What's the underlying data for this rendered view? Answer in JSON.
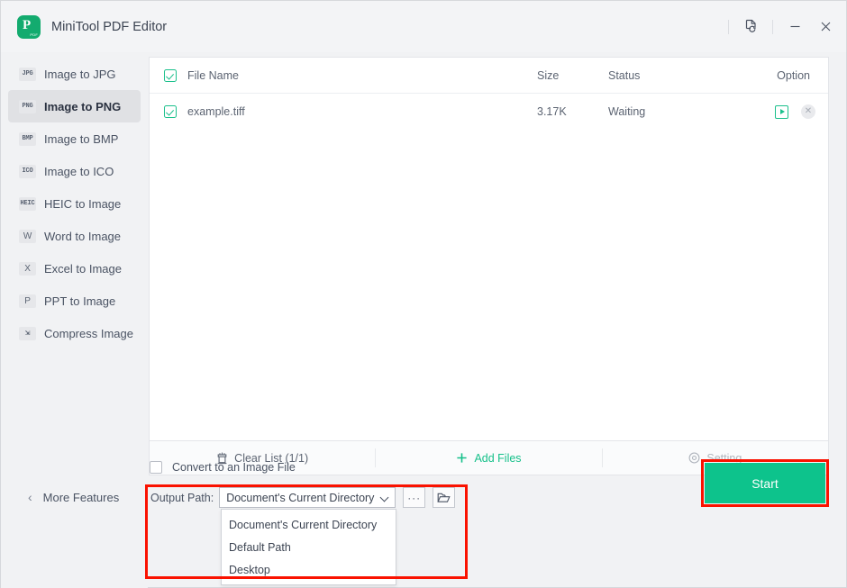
{
  "window": {
    "title": "MiniTool PDF Editor",
    "logo_letter": "P",
    "logo_sub": "PDF",
    "controls": [
      {
        "name": "document-refresh-icon",
        "label": ""
      },
      {
        "name": "minimize-icon",
        "label": ""
      },
      {
        "name": "close-icon",
        "label": ""
      }
    ]
  },
  "sidebar": {
    "items": [
      {
        "badge": "JPG",
        "label": "Image to JPG",
        "active": false
      },
      {
        "badge": "PNG",
        "label": "Image to PNG",
        "active": true
      },
      {
        "badge": "BMP",
        "label": "Image to BMP",
        "active": false
      },
      {
        "badge": "ICO",
        "label": "Image to ICO",
        "active": false
      },
      {
        "badge": "HEIC",
        "label": "HEIC to Image",
        "active": false
      },
      {
        "badge": "W",
        "label": "Word to Image",
        "active": false
      },
      {
        "badge": "X",
        "label": "Excel to Image",
        "active": false
      },
      {
        "badge": "P",
        "label": "PPT to Image",
        "active": false
      },
      {
        "badge": "⇲",
        "label": "Compress Image",
        "active": false
      }
    ],
    "more_features": "More Features"
  },
  "file_table": {
    "columns": {
      "name": "File Name",
      "size": "Size",
      "status": "Status",
      "option": "Option"
    },
    "rows": [
      {
        "name": "example.tiff",
        "size": "3.17K",
        "status": "Waiting",
        "checked": true
      }
    ]
  },
  "action_bar": {
    "clear_list": "Clear List (1/1)",
    "add_files": "Add Files",
    "setting": "Setting"
  },
  "bottom": {
    "convert_checkbox_label": "Convert to an Image File",
    "convert_checked": false,
    "output_path_label": "Output Path:",
    "output_path_value": "Document's Current Directory",
    "browse_dots": "···",
    "dropdown_options": [
      "Document's Current Directory",
      "Default Path",
      "Desktop"
    ],
    "start_label": "Start"
  },
  "colors": {
    "accent_green": "#0dc38c",
    "check_green": "#1bc08c",
    "annotation_red": "#fa1200",
    "window_bg": "#f1f2f4",
    "panel_bg": "#ffffff",
    "text_primary": "#3c4452",
    "text_secondary": "#5c6472",
    "disabled_text": "#b0b5bd"
  }
}
